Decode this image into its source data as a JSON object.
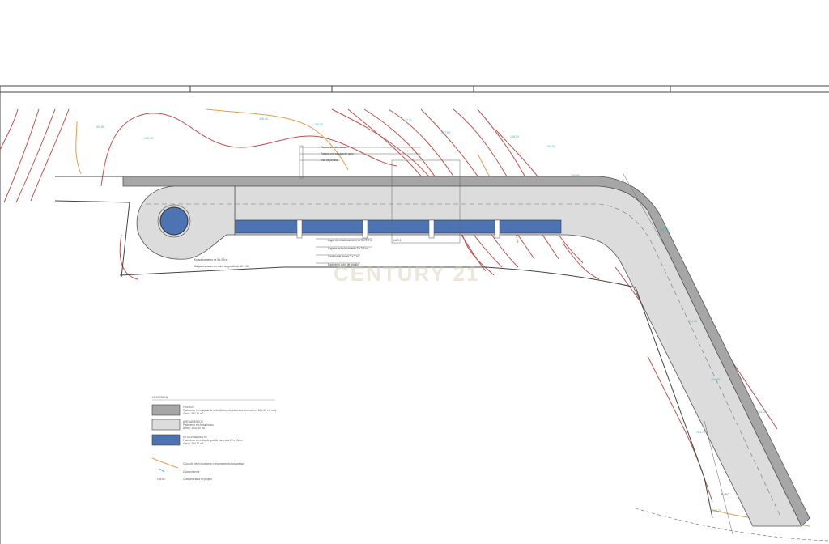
{
  "watermark": "CENTURY 21",
  "legend": {
    "title": "LEGENDA",
    "items": [
      {
        "name": "PASSEIO",
        "desc1": "Pavimento em calçada de cubo (blocos de betonilha com redes - 10 x 20 x 8 mm)",
        "desc2": "Área = 387.30 m2",
        "swatch": "#a6a6a6"
      },
      {
        "name": "ARRUAMENTOS",
        "desc1": "Pavimento em betuminoso",
        "desc2": "Área = 1932.80 m2",
        "swatch": "#dcdcdc"
      },
      {
        "name": "ESTACIONAMENTO",
        "desc1": "Pavimento em cubo de granito para vias 10 x 10mm",
        "desc2": "Área = 254.70 m2",
        "swatch": "#4d73b3"
      }
    ],
    "lines": [
      {
        "label": "Curva de nível (conforme o levantamento topográfico)"
      },
      {
        "label": "Cota existente"
      },
      {
        "code": "105.60",
        "label": "Cota projetada no projeto"
      }
    ]
  },
  "callouts": [
    "Pavimento betuminoso",
    "Passeio em calçada de cubo",
    "Vias de projeto",
    "Lugar de estacionamento de 5 x 2.5 m",
    "Lugares estacionamento 5 x 2.5 m",
    "Caldeira de árvore 1 x 1 m",
    "Pavimento cubo de granito"
  ],
  "labels": {
    "roundabout_label": "Estacionamento de 5 x 2.5 m",
    "roundabout_label2": "Calçada circular em cubo de granito de 10 x 10",
    "parking_note": "LUG 4",
    "curve_label": "R = 9.0"
  },
  "elevations": [
    "105.80",
    "106.10",
    "106.40",
    "106.90",
    "107.20",
    "107.60",
    "108.00",
    "108.40",
    "108.90",
    "109.30",
    "104.90",
    "104.50",
    "104.10",
    "103.70",
    "103.20"
  ],
  "colors": {
    "contour": "#c0504d",
    "sidewalk": "#a6a6a6",
    "road": "#dcdcdc",
    "parking": "#4d73b3",
    "cyan_text": "#2fb4c8",
    "orange_line": "#e0a050"
  }
}
